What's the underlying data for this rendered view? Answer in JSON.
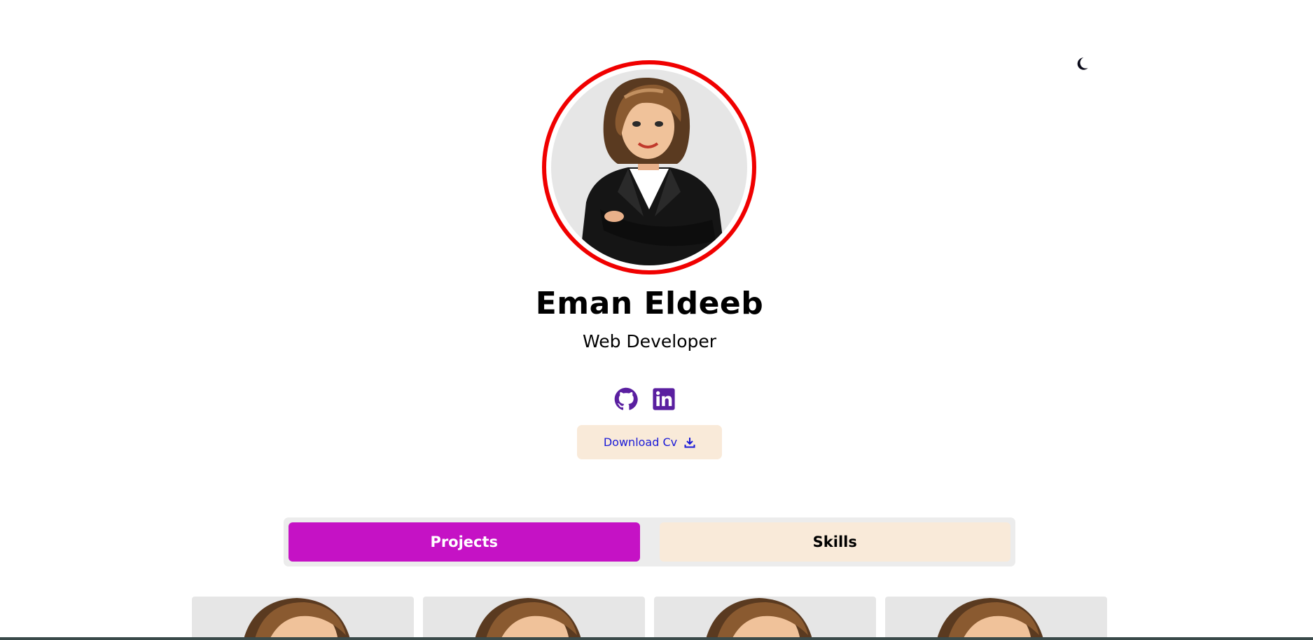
{
  "header": {
    "theme_toggle_icon": "moon-icon"
  },
  "profile": {
    "name": "Eman Eldeeb",
    "role": "Web Developer",
    "avatar_border_color": "#f00000"
  },
  "socials": {
    "items": [
      {
        "icon": "github-icon"
      },
      {
        "icon": "linkedin-icon"
      }
    ],
    "color": "#5a1fa0"
  },
  "cv_button": {
    "label": "Download Cv",
    "icon": "download-icon"
  },
  "tabs": [
    {
      "label": "Projects",
      "active": true
    },
    {
      "label": "Skills",
      "active": false
    }
  ],
  "colors": {
    "accent": "#c512c5",
    "cream": "#f9ead9",
    "link": "#1a1ad8"
  }
}
